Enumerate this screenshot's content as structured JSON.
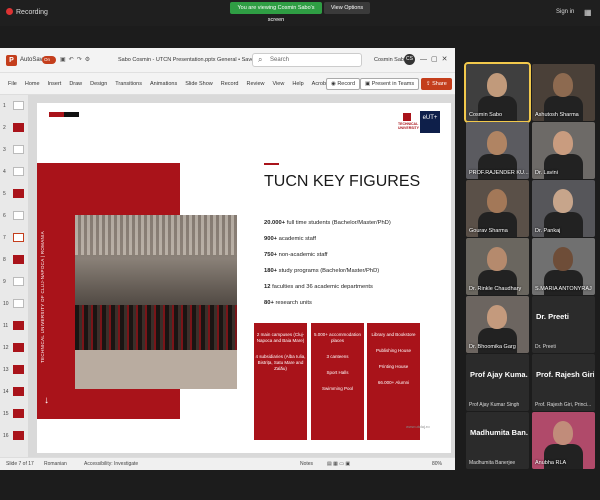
{
  "meeting": {
    "recording_label": "Recording",
    "share_banner": "You are viewing Cosmin Sabo's screen",
    "view_options_label": "View Options",
    "sign_in_label": "Sign in"
  },
  "ppt": {
    "autosave_label": "AutoSave",
    "autosave_state": "On",
    "doc_name": "Sabo Cosmin - UTCN Presentation.pptx",
    "doc_status": "General • Saved",
    "search_placeholder": "Search",
    "user_name": "Cosmin Sabo",
    "user_initials": "CS",
    "menu": [
      "File",
      "Home",
      "Insert",
      "Draw",
      "Design",
      "Transitions",
      "Animations",
      "Slide Show",
      "Record",
      "Review",
      "View",
      "Help",
      "Acrobat"
    ],
    "record_button": "Record",
    "present_teams_button": "Present in Teams",
    "share_button": "Share",
    "thumbnails": [
      "1",
      "2",
      "3",
      "4",
      "5",
      "6",
      "7",
      "8",
      "9",
      "10",
      "11",
      "12",
      "13",
      "14",
      "15",
      "16"
    ],
    "status": {
      "slide_counter": "Slide 7 of 17",
      "language": "Romanian",
      "accessibility": "Accessibility: Investigate",
      "notes": "Notes",
      "zoom": "80%"
    }
  },
  "slide": {
    "title": "TUCN KEY FIGURES",
    "vertical_text": "TECHNICAL UNIVERSITY OF CLUJ-NAPOCA  |  ROMANIA",
    "figures": [
      {
        "num": "20.000+",
        "text": " full time students (Bachelor/Master/PhD)"
      },
      {
        "num": "900+",
        "text": " academic staff"
      },
      {
        "num": "750+",
        "text": " non-academic staff"
      },
      {
        "num": "180+",
        "text": " study programs (Bachelor/Master/PhD)"
      },
      {
        "num": "12",
        "text": " faculties and 36 academic departments"
      },
      {
        "num": "80+",
        "text": " research units"
      }
    ],
    "boxes": [
      [
        "2 main campuses (Cluj-Napoca and Baia Mare)",
        "4 subsidiaries (Alba Iulia, Bistrița, Satu Mare and Zalău)"
      ],
      [
        "5.000+ accommodation places",
        "3 canteens",
        "Sport Halls",
        "Swimming Pool"
      ],
      [
        "Library and Bookstore",
        "Publishing House",
        "Printing House",
        "66.000+ Alumni"
      ]
    ],
    "logo1_text": "TECHNICAL UNIVERSITY",
    "logo2_text": "eUT+",
    "url": "www.utcluj.ro"
  },
  "participants": [
    {
      "name": "Cosmin Sabo",
      "video": true,
      "active": true
    },
    {
      "name": "Ashutosh Sharma",
      "video": true
    },
    {
      "name": "PROF.RAJENDER KU...",
      "video": true
    },
    {
      "name": "Dr. Lavini",
      "video": true
    },
    {
      "name": "Gourav Sharma",
      "video": true
    },
    {
      "name": "Dr. Pankaj",
      "video": true
    },
    {
      "name": "Dr. Rinkle Chaudhary",
      "video": true
    },
    {
      "name": "S.MARIA ANTONYRAJ",
      "video": true
    },
    {
      "name": "Dr. Bhoomika Garg",
      "video": true
    },
    {
      "name": "Dr. Preeti",
      "big": "Dr. Preeti",
      "video": false
    },
    {
      "name": "Prof Ajay Kumar Singh",
      "big": "Prof Ajay Kuma...",
      "video": false
    },
    {
      "name": "Prof. Rajesh Giri, Princi...",
      "big": "Prof. Rajesh Giri...",
      "video": false
    },
    {
      "name": "Madhumita Banerjee",
      "big": "Madhumita Ban...",
      "video": false
    },
    {
      "name": "Anubha RLA",
      "video": true
    }
  ]
}
